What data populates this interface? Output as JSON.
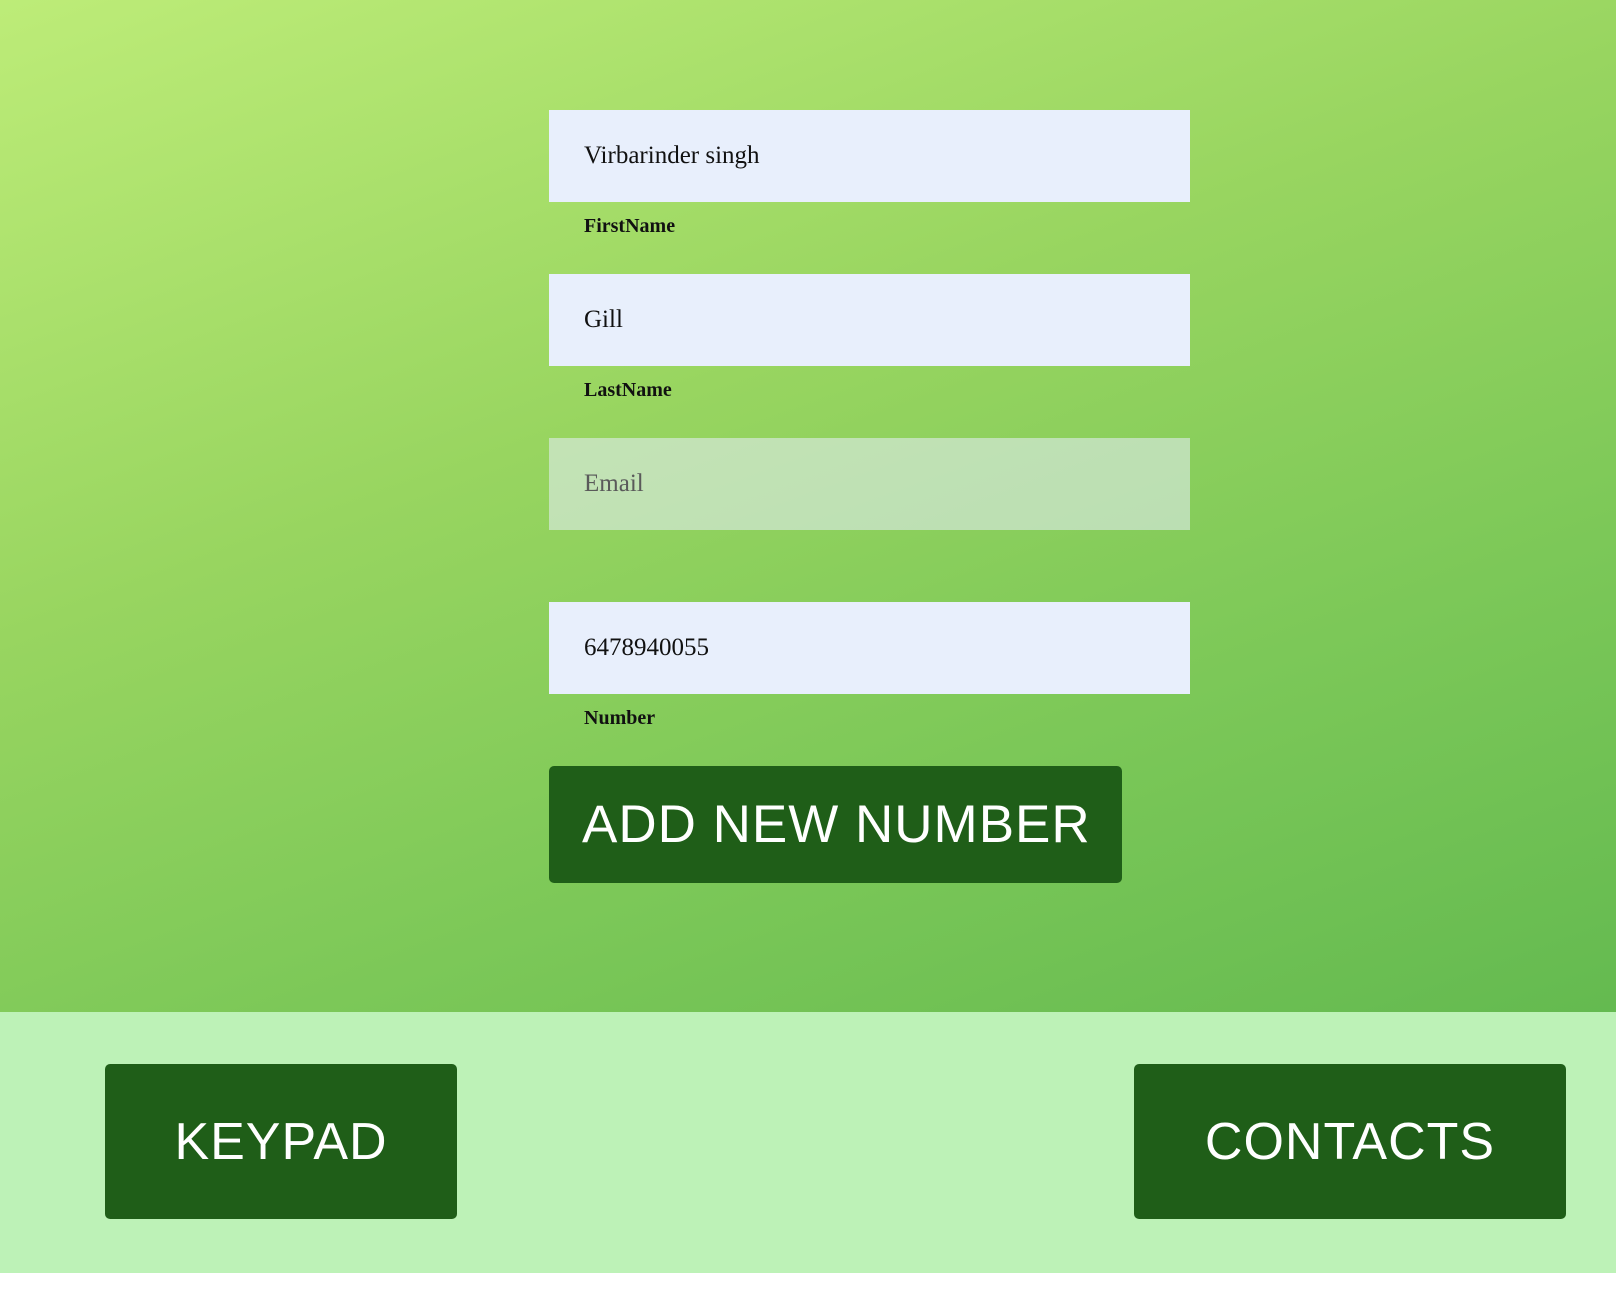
{
  "form": {
    "first_name": {
      "value": "Virbarinder singh",
      "label": "FirstName"
    },
    "last_name": {
      "value": "Gill",
      "label": "LastName"
    },
    "email": {
      "value": "",
      "placeholder": "Email",
      "label": ""
    },
    "number": {
      "value": "6478940055",
      "label": "Number"
    },
    "submit_label": "ADD NEW NUMBER"
  },
  "footer": {
    "keypad_label": "KEYPAD",
    "contacts_label": "CONTACTS"
  },
  "colors": {
    "button_bg": "#1f5e18",
    "footer_bg": "#bdf2b7",
    "input_bg": "#e8effc"
  }
}
